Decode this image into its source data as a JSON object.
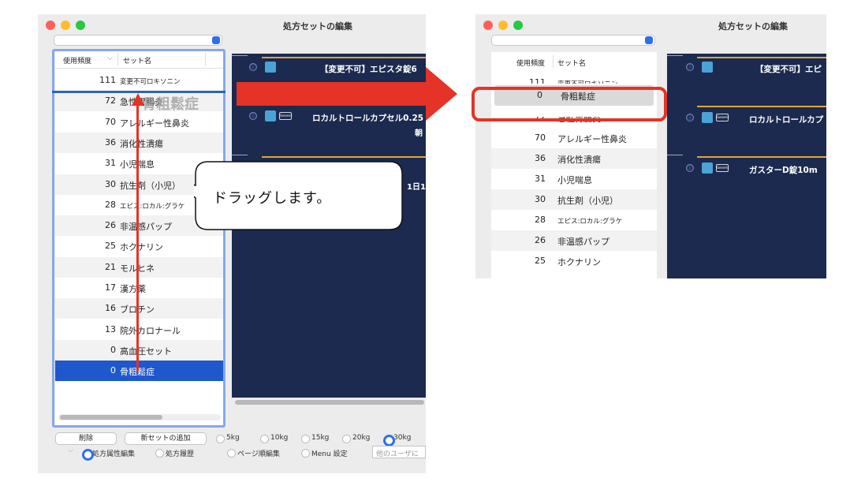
{
  "colors": {
    "accent": "#1f57cc",
    "annotation_red": "#e53327",
    "panel_navy": "#1b2a4e",
    "card_gold": "#e0a63a"
  },
  "left_window": {
    "title": "処方セットの編集",
    "list_header": {
      "freq": "使用頻度",
      "name": "セット名",
      "sort_icon": "chevron-down-icon"
    },
    "rows": [
      {
        "num": "111",
        "name": "変更不可ロキソニン",
        "small": true
      },
      {
        "num": "72",
        "name": "急性胃腸炎"
      },
      {
        "num": "70",
        "name": "アレルギー性鼻炎"
      },
      {
        "num": "36",
        "name": "消化性潰瘍"
      },
      {
        "num": "31",
        "name": "小児喘息"
      },
      {
        "num": "30",
        "name": "抗生剤（小児）"
      },
      {
        "num": "28",
        "name": "エピス:ロカル:グラケ",
        "small": true
      },
      {
        "num": "26",
        "name": "非温感パップ"
      },
      {
        "num": "25",
        "name": "ホクナリン"
      },
      {
        "num": "21",
        "name": "モルヒネ"
      },
      {
        "num": "17",
        "name": "漢方薬"
      },
      {
        "num": "16",
        "name": "ブロチン"
      },
      {
        "num": "13",
        "name": "院外カロナール"
      },
      {
        "num": "0",
        "name": "高血圧セット"
      },
      {
        "num": "0",
        "name": "骨粗鬆症",
        "selected": true
      }
    ],
    "drag_ghost": "骨粗鬆症",
    "cards": [
      {
        "text": "【変更不可】エピスタ錠6",
        "sub": ""
      },
      {
        "text": "ロカルトロールカプセル0.25",
        "sub": "朝"
      },
      {
        "text": "",
        "sub": "1日1"
      }
    ],
    "buttons": {
      "delete": "削除",
      "add": "新セットの追加"
    },
    "weights": [
      "5kg",
      "10kg",
      "15kg",
      "20kg",
      "30kg"
    ],
    "weight_selected": "30kg",
    "radios": [
      "処方属性編集",
      "処方履歴",
      "ページ順編集",
      "Menu 設定"
    ],
    "radio_selected": "処方属性編集",
    "search_placeholder": "他のユーザに"
  },
  "right_window": {
    "title": "処方セットの編集",
    "list_header": {
      "freq": "使用頻度",
      "name": "セット名"
    },
    "rows": [
      {
        "num": "111",
        "name": "変更不可ロキソニン",
        "small": true,
        "clipped": true
      },
      {
        "num": "0",
        "name": "骨粗鬆症",
        "moved": true
      },
      {
        "num": "72",
        "name": "急性胃腸炎",
        "clipped": true
      },
      {
        "num": "70",
        "name": "アレルギー性鼻炎"
      },
      {
        "num": "36",
        "name": "消化性潰瘍"
      },
      {
        "num": "31",
        "name": "小児喘息"
      },
      {
        "num": "30",
        "name": "抗生剤（小児）"
      },
      {
        "num": "28",
        "name": "エピス:ロカル:グラケ",
        "small": true
      },
      {
        "num": "26",
        "name": "非温感パップ"
      },
      {
        "num": "25",
        "name": "ホクナリン"
      }
    ],
    "cards": [
      {
        "text": "【変更不可】エピ"
      },
      {
        "text": "ロカルトロールカプ"
      },
      {
        "text": "ガスターD錠10m"
      }
    ]
  },
  "annotation": {
    "callout": "ドラッグします。"
  }
}
